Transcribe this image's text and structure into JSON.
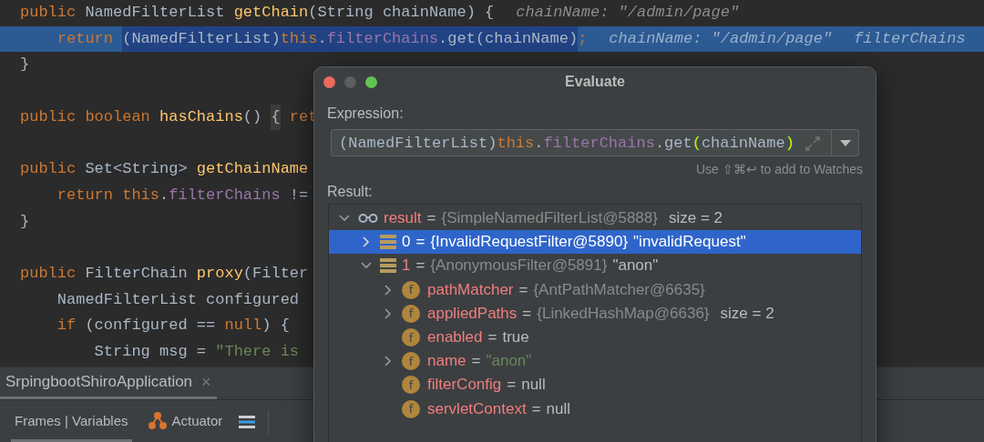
{
  "editor": {
    "lines": [
      {
        "current": false,
        "tokens": [
          {
            "kind": "kw",
            "text": "public "
          },
          {
            "kind": "plain",
            "text": "NamedFilterList "
          },
          {
            "kind": "fn",
            "text": "getChain"
          },
          {
            "kind": "plain",
            "text": "(String chainName) {"
          },
          {
            "kind": "hint",
            "text": "chainName: \"/admin/page\""
          }
        ]
      },
      {
        "current": true,
        "tokens": [
          {
            "kind": "kw",
            "text": "    return ",
            "selected": false
          },
          {
            "kind": "plain",
            "text": "(NamedFilterList)",
            "selected": true
          },
          {
            "kind": "kw",
            "text": "this",
            "selected": true
          },
          {
            "kind": "plain",
            "text": ".",
            "selected": true
          },
          {
            "kind": "field",
            "text": "filterChains",
            "selected": true
          },
          {
            "kind": "plain",
            "text": ".get(chainName)",
            "selected": true
          },
          {
            "kind": "kw",
            "text": ";",
            "selected": false
          },
          {
            "kind": "hint",
            "text": "chainName: \"/admin/page\"",
            "selected": false
          },
          {
            "kind": "hint",
            "text": "filterChains",
            "selected": false
          }
        ]
      },
      {
        "current": false,
        "tokens": [
          {
            "kind": "plain",
            "text": "}"
          }
        ]
      },
      {
        "current": false
      },
      {
        "current": false,
        "tokens": [
          {
            "kind": "kw",
            "text": "public boolean "
          },
          {
            "kind": "fn",
            "text": "hasChains"
          },
          {
            "kind": "plain",
            "text": "() "
          },
          {
            "kind": "boxed",
            "text": "{"
          },
          {
            "kind": "kw",
            "text": " ret"
          }
        ]
      },
      {
        "current": false
      },
      {
        "current": false,
        "tokens": [
          {
            "kind": "kw",
            "text": "public "
          },
          {
            "kind": "plain",
            "text": "Set<String> "
          },
          {
            "kind": "fn",
            "text": "getChainName"
          }
        ]
      },
      {
        "current": false,
        "tokens": [
          {
            "kind": "kw",
            "text": "    return this"
          },
          {
            "kind": "plain",
            "text": "."
          },
          {
            "kind": "field",
            "text": "filterChains"
          },
          {
            "kind": "plain",
            "text": " !="
          }
        ]
      },
      {
        "current": false,
        "tokens": [
          {
            "kind": "plain",
            "text": "}"
          }
        ]
      },
      {
        "current": false
      },
      {
        "current": false,
        "tokens": [
          {
            "kind": "kw",
            "text": "public "
          },
          {
            "kind": "plain",
            "text": "FilterChain "
          },
          {
            "kind": "fn",
            "text": "proxy"
          },
          {
            "kind": "plain",
            "text": "(Filter"
          }
        ]
      },
      {
        "current": false,
        "tokens": [
          {
            "kind": "plain",
            "text": "    NamedFilterList configured"
          }
        ]
      },
      {
        "current": false,
        "tokens": [
          {
            "kind": "kw",
            "text": "    if "
          },
          {
            "kind": "plain",
            "text": "(configured == "
          },
          {
            "kind": "kw",
            "text": "null"
          },
          {
            "kind": "plain",
            "text": ") {"
          }
        ]
      },
      {
        "current": false,
        "tokens": [
          {
            "kind": "plain",
            "text": "        String msg = "
          },
          {
            "kind": "str",
            "text": "\"There is"
          }
        ]
      }
    ]
  },
  "run_panel": {
    "tab": {
      "label": "SrpingbootShiroApplication",
      "close": "×"
    },
    "tabs": [
      {
        "label": "Frames | Variables",
        "selected": true
      },
      {
        "label": "Actuator",
        "selected": false
      }
    ]
  },
  "dialog": {
    "title": "Evaluate",
    "expression_label": "Expression:",
    "expression": [
      {
        "kind": "plain",
        "text": "(NamedFilterList)"
      },
      {
        "kind": "kw",
        "text": "this"
      },
      {
        "kind": "plain",
        "text": "."
      },
      {
        "kind": "field",
        "text": "filterChains"
      },
      {
        "kind": "plain",
        "text": ".get"
      },
      {
        "kind": "match",
        "text": "("
      },
      {
        "kind": "plain",
        "text": "chainName"
      },
      {
        "kind": "match",
        "text": ")"
      }
    ],
    "hint": "Use ⇧⌘↩ to add to Watches",
    "result_label": "Result:",
    "tree": [
      {
        "kind": "watch",
        "name": "result",
        "eq": "=",
        "value": {
          "kind": "ref",
          "text": "{SimpleNamedFilterList@5888}"
        },
        "extra": "size = 2",
        "expanded": true,
        "selected": false,
        "children": [
          {
            "kind": "list",
            "name": "0",
            "eq": "=",
            "value": {
              "kind": "ref",
              "text": "{InvalidRequestFilter@5890}"
            },
            "extra": "\"invalidRequest\"",
            "expanded": false,
            "selected": true
          },
          {
            "kind": "list",
            "name": "1",
            "eq": "=",
            "value": {
              "kind": "ref",
              "text": "{AnonymousFilter@5891}"
            },
            "extra": "\"anon\"",
            "expanded": true,
            "selected": false,
            "children": [
              {
                "kind": "field",
                "badge": "f",
                "name": "pathMatcher",
                "eq": "=",
                "value": {
                  "kind": "ref",
                  "text": "{AntPathMatcher@6635}"
                },
                "expanded": false,
                "selected": false
              },
              {
                "kind": "field",
                "badge": "f",
                "name": "appliedPaths",
                "eq": "=",
                "value": {
                  "kind": "ref",
                  "text": "{LinkedHashMap@6636}"
                },
                "extra": "size = 2",
                "expanded": false,
                "selected": false
              },
              {
                "kind": "field",
                "badge": "f",
                "name": "enabled",
                "eq": "=",
                "value": {
                  "kind": "plain",
                  "text": "true"
                },
                "selected": false
              },
              {
                "kind": "field",
                "badge": "f",
                "name": "name",
                "eq": "=",
                "value": {
                  "kind": "string",
                  "text": "\"anon\""
                },
                "expanded": false,
                "selected": false
              },
              {
                "kind": "field",
                "badge": "f",
                "name": "filterConfig",
                "eq": "=",
                "value": {
                  "kind": "plain",
                  "text": "null"
                },
                "selected": false
              },
              {
                "kind": "field",
                "badge": "f",
                "name": "servletContext",
                "eq": "=",
                "value": {
                  "kind": "plain",
                  "text": "null"
                },
                "selected": false
              }
            ]
          }
        ]
      }
    ]
  }
}
